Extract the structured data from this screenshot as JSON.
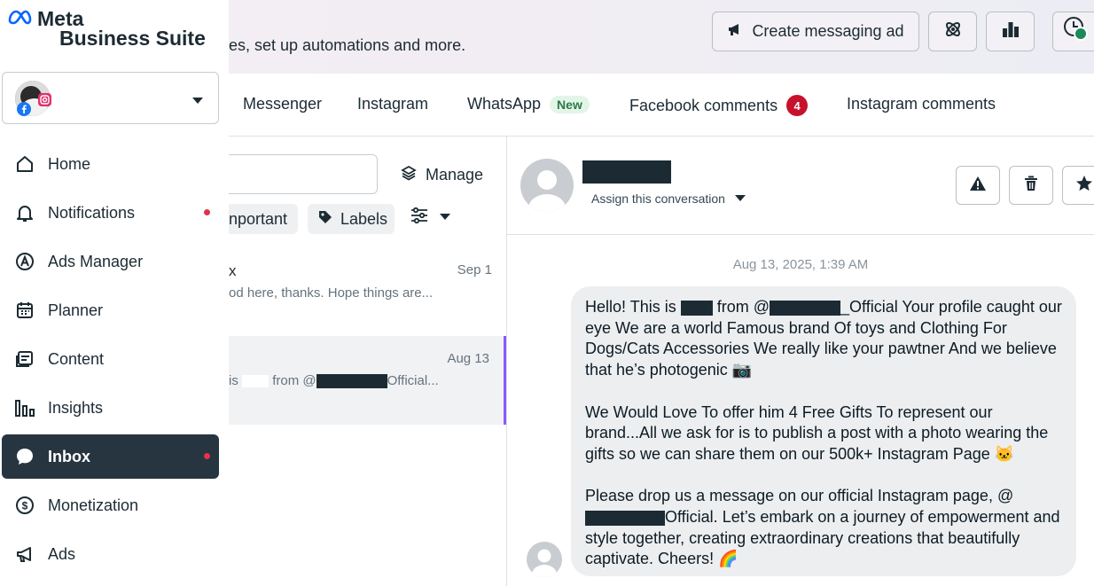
{
  "banner": {
    "text": "es, set up automations and more.",
    "create_ad_label": "Create messaging ad"
  },
  "tabs": [
    {
      "label": "Messenger"
    },
    {
      "label": "Instagram"
    },
    {
      "label": "WhatsApp",
      "badge": "New"
    },
    {
      "label": "Facebook comments",
      "count": "4"
    },
    {
      "label": "Instagram comments"
    }
  ],
  "list": {
    "manage_label": "Manage",
    "important_label": "nportant",
    "labels_label": "Labels",
    "conversations": [
      {
        "name": "x",
        "date": "Sep 1",
        "snippet": "od here, thanks. Hope things are..."
      },
      {
        "date": "Aug 13",
        "snippet_prefix": "is",
        "snippet_mid": "from @",
        "snippet_suffix": "Official..."
      }
    ]
  },
  "thread": {
    "assign_label": "Assign this conversation",
    "date": "Aug 13, 2025, 1:39 AM",
    "message": {
      "line1a": "Hello! This is",
      "line1b": "from @",
      "line1c": "_Official Your profile caught our eye We are a world Famous brand Of toys and Clothing For Dogs/Cats Accessories We really like your pawtner And we believe that he’s photogenic 📷",
      "para2": "We Would Love To offer him 4 Free Gifts To represent our brand...All we ask for is to publish a post with a photo wearing the gifts so we can share them on our 500k+ Instagram Page 🐱",
      "para3a": "Please drop us a message on our official Instagram page, @",
      "para3b": "Official. Let’s embark on a journey of empowerment and style together, creating extraordinary creations that beautifully captivate. Cheers! 🌈"
    }
  },
  "sidebar": {
    "logo_line1": "Meta",
    "logo_line2": "Business Suite",
    "items": [
      {
        "label": "Home",
        "icon": "home-icon"
      },
      {
        "label": "Notifications",
        "icon": "bell-icon",
        "dot": true
      },
      {
        "label": "Ads Manager",
        "icon": "ads-manager-icon"
      },
      {
        "label": "Planner",
        "icon": "calendar-icon"
      },
      {
        "label": "Content",
        "icon": "content-icon"
      },
      {
        "label": "Insights",
        "icon": "insights-icon"
      },
      {
        "label": "Inbox",
        "icon": "chat-bubble-icon",
        "active": true,
        "dot": true
      },
      {
        "label": "Monetization",
        "icon": "dollar-icon"
      },
      {
        "label": "Ads",
        "icon": "megaphone-icon"
      }
    ]
  },
  "colors": {
    "nav_active_bg": "#273540",
    "badge_red": "#c8112a",
    "new_badge_green": "#2a7a45",
    "selected_accent": "#8a5cf6"
  }
}
